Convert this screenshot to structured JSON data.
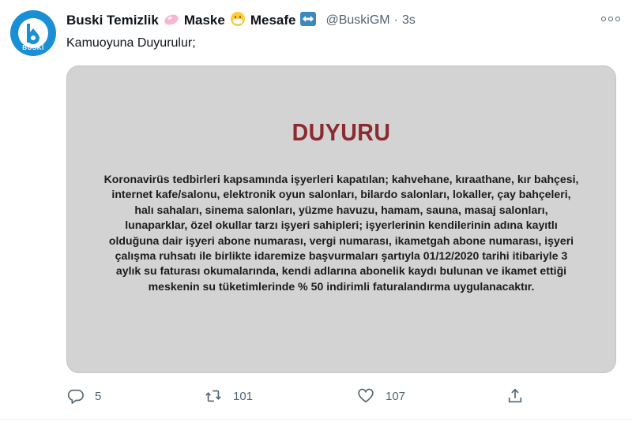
{
  "tweet": {
    "display_name": "Buski Temizlik",
    "name_word_2": "Maske",
    "name_word_3": "Mesafe",
    "emoji_1": "soap-emoji",
    "emoji_2": "face-with-mask-emoji",
    "emoji_3": "left-right-arrow-emoji",
    "handle": "@BuskiGM",
    "separator": "·",
    "time": "3s",
    "text": "Kamuoyuna Duyurulur;",
    "avatar_text": "BUSKİ"
  },
  "image": {
    "title": "DUYURU",
    "body": "Koronavirüs tedbirleri kapsamında işyerleri kapatılan; kahvehane, kıraathane, kır bahçesi, internet kafe/salonu, elektronik oyun salonları, bilardo salonları, lokaller, çay bahçeleri, halı sahaları, sinema salonları, yüzme havuzu, hamam, sauna, masaj salonları, lunaparklar, özel okullar tarzı işyeri sahipleri; işyerlerinin kendilerinin adına kayıtlı olduğuna dair işyeri abone numarası, vergi numarası, ikametgah abone numarası, işyeri çalışma ruhsatı ile birlikte idaremize başvurmaları şartıyla 01/12/2020 tarihi itibariyle 3 aylık su faturası okumalarında, kendi adlarına abonelik kaydı bulunan ve ikamet ettiği meskenin su tüketimlerinde % 50 indirimli faturalandırma uygulanacaktır.",
    "title_color": "#8b2a2f",
    "background_color": "#d3d3d3"
  },
  "actions": {
    "reply_count": "5",
    "retweet_count": "101",
    "like_count": "107"
  },
  "colors": {
    "accent": "#1a8fd6",
    "muted": "#536471"
  }
}
